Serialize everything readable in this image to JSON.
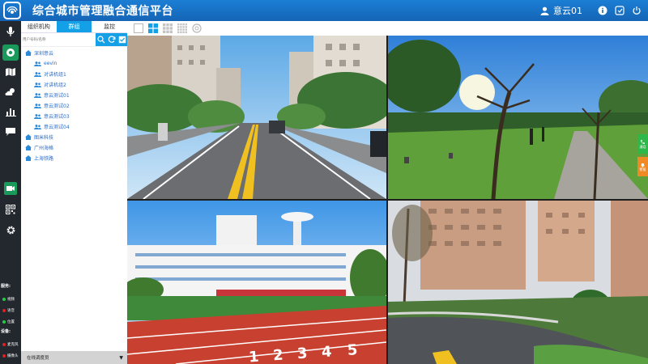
{
  "header": {
    "title": "综合城市管理融合通信平台",
    "user_name": "意云01",
    "icons": [
      "app-logo-icon",
      "user-icon",
      "info-icon",
      "fullscreen-icon",
      "power-icon"
    ]
  },
  "nav": {
    "icons": [
      "microphone-icon",
      "eye-icon",
      "map-icon",
      "weather-icon",
      "chart-icon",
      "chat-icon",
      "video-call-icon",
      "qr-code-icon",
      "gear-icon"
    ]
  },
  "legend": {
    "service_title": "服务:",
    "service_items": [
      {
        "label": "视频",
        "color": "#22cc44"
      },
      {
        "label": "语音",
        "color": "#e02020"
      },
      {
        "label": "位置",
        "color": "#22cc44"
      }
    ],
    "device_title": "设备:",
    "device_items": [
      {
        "label": "麦克风",
        "color": "#e02020"
      },
      {
        "label": "摄像头",
        "color": "#e02020"
      }
    ]
  },
  "sidebar": {
    "tabs": [
      {
        "label": "组织机构",
        "active": false
      },
      {
        "label": "群组",
        "active": true
      },
      {
        "label": "监控",
        "active": false
      }
    ],
    "search_placeholder": "用户号码/名称",
    "tree": {
      "root": "深圳意云",
      "children": [
        "eevin",
        "对讲机组1",
        "对讲机组2",
        "意云测试01",
        "意云测试02",
        "意云测试03",
        "意云测试04"
      ],
      "siblings": [
        "图米科技",
        "广州海格",
        "上海铁路"
      ]
    },
    "footer_label": "在线调度员"
  },
  "toolbar": {
    "layouts": [
      "1x1",
      "2x2",
      "3x3",
      "4x4",
      "loop"
    ],
    "active_layout": "2x2"
  },
  "float_buttons": {
    "top_label": "通话",
    "bottom_label": "警报"
  }
}
